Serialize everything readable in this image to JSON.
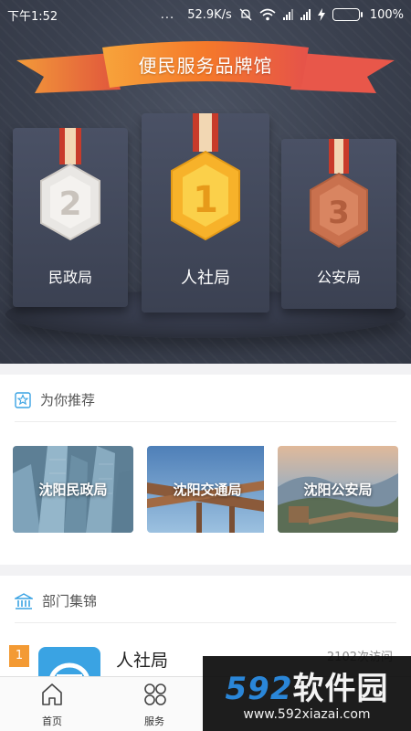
{
  "status_bar": {
    "time": "下午1:52",
    "dots": "...",
    "speed": "52.9K/s",
    "battery": "100%",
    "battery_color": "#4cd964"
  },
  "hero": {
    "banner_title": "便民服务品牌馆",
    "medals": [
      {
        "rank": "2",
        "label": "民政局"
      },
      {
        "rank": "1",
        "label": "人社局"
      },
      {
        "rank": "3",
        "label": "公安局"
      }
    ]
  },
  "recommend": {
    "title": "为你推荐",
    "icon": "star-icon",
    "items": [
      {
        "label": "沈阳民政局"
      },
      {
        "label": "沈阳交通局"
      },
      {
        "label": "沈阳公安局"
      }
    ]
  },
  "departments": {
    "title": "部门集锦",
    "icon": "institution-icon",
    "items": [
      {
        "rank": "1",
        "name": "人社局",
        "visits": "2102次访问"
      }
    ]
  },
  "tabbar": {
    "tabs": [
      {
        "label": "首页",
        "icon": "home-icon"
      },
      {
        "label": "服务",
        "icon": "grid-icon"
      }
    ]
  },
  "watermark": {
    "brand_number": "592",
    "brand_text": "软件园",
    "url": "www.592xiazai.com"
  },
  "colors": {
    "accent_orange": "#f47a2a",
    "accent_blue": "#3aa3e3"
  }
}
